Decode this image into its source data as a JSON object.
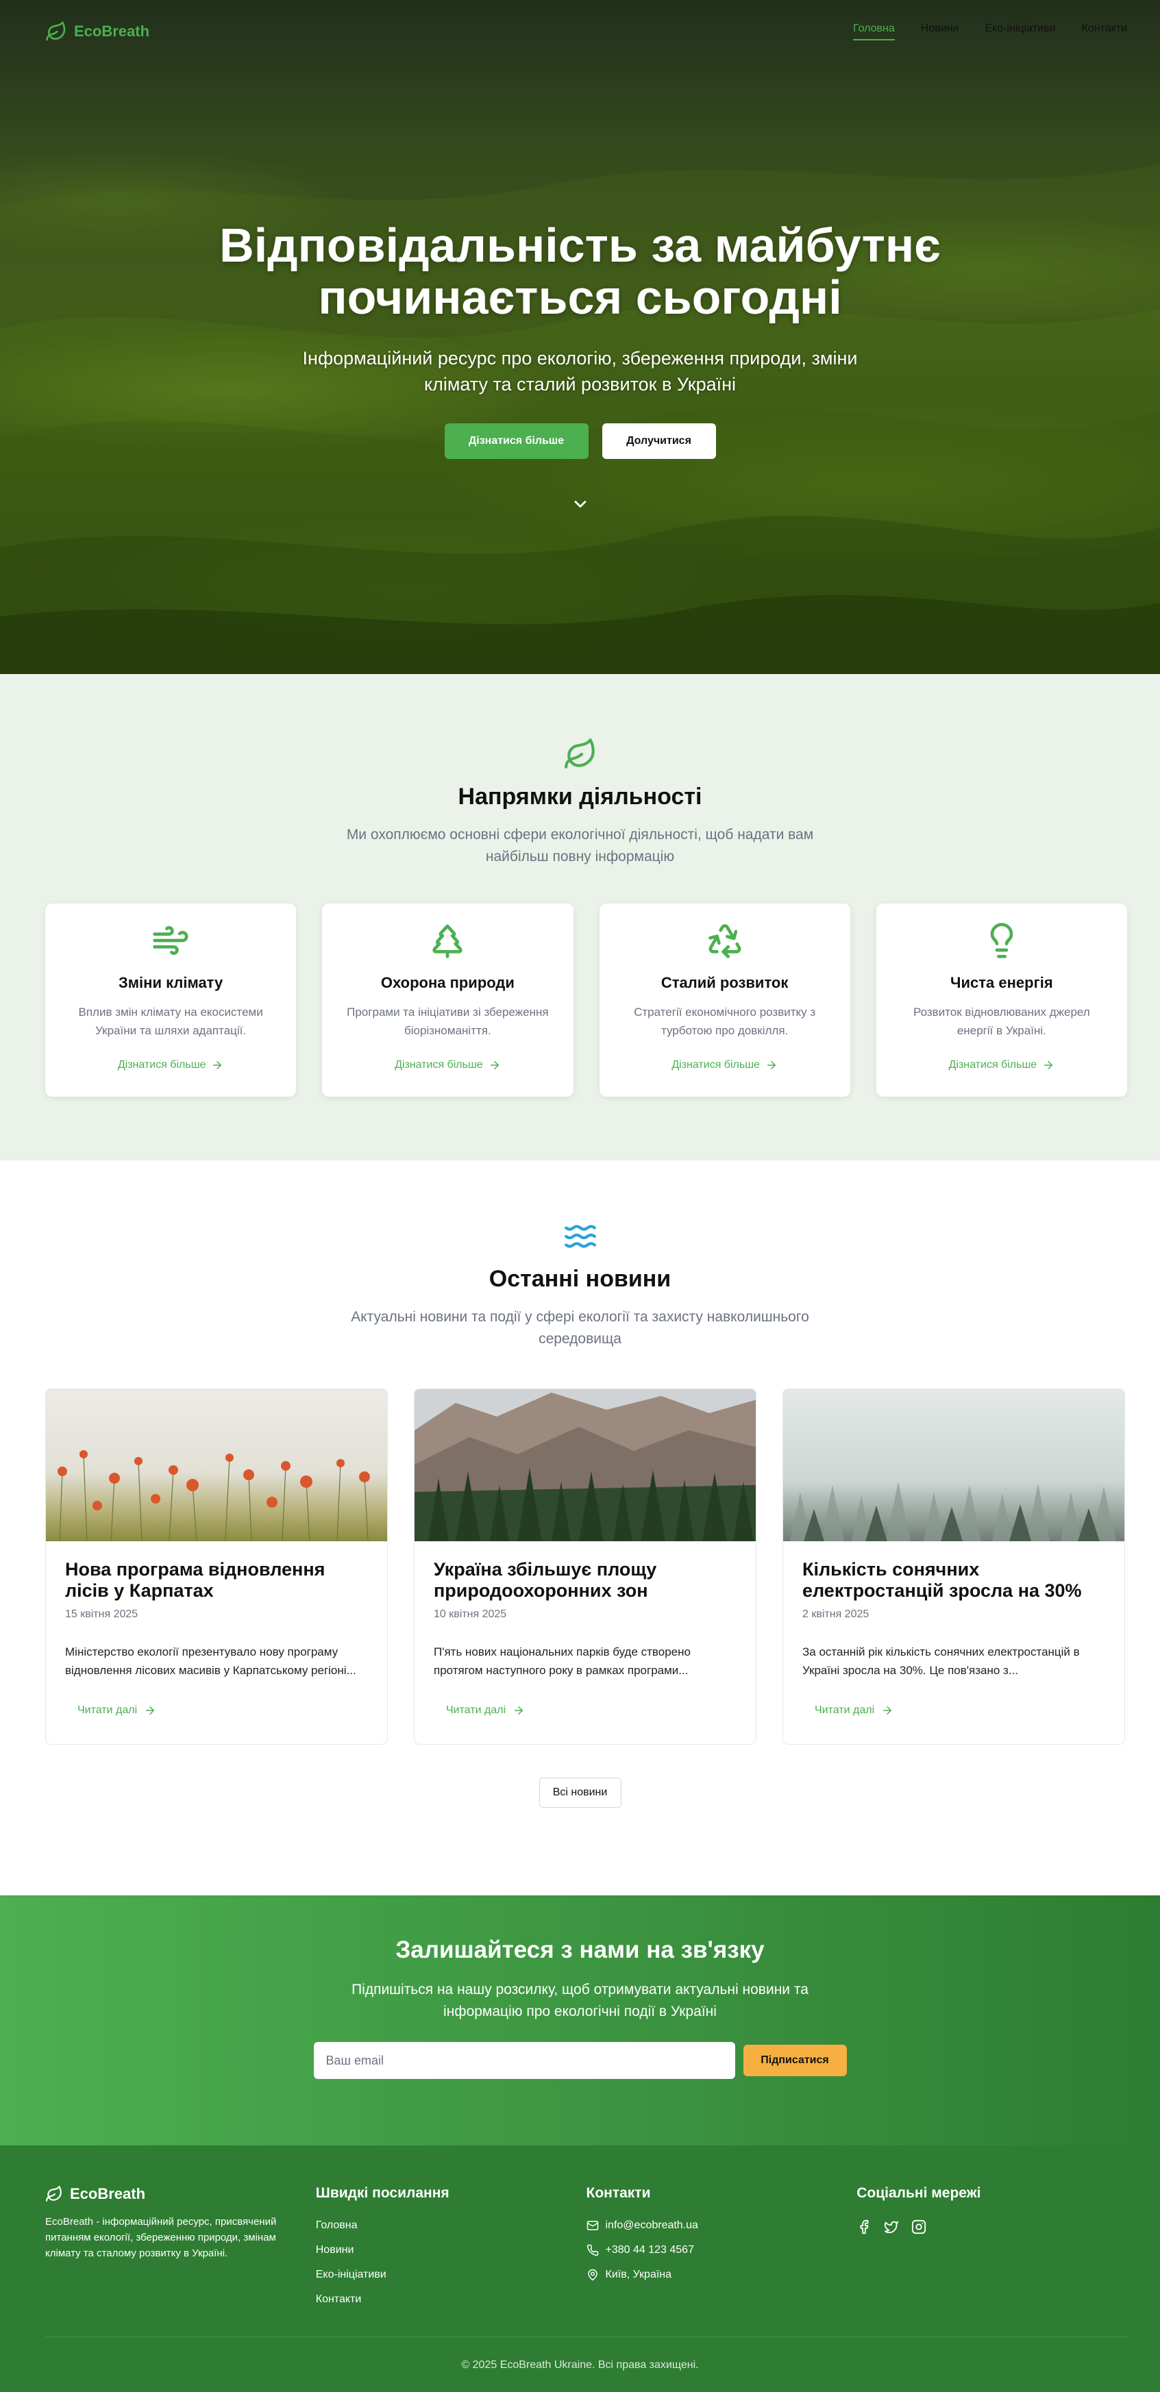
{
  "nav": {
    "brand": "EcoBreath",
    "links": [
      "Головна",
      "Новини",
      "Еко-ініціативи",
      "Контакти"
    ]
  },
  "hero": {
    "title": "Відповідальність за майбутнє починається сьогодні",
    "subtitle": "Інформаційний ресурс про екологію, збереження природи, зміни клімату та сталий розвиток в Україні",
    "primary_button": "Дізнатися більше",
    "secondary_button": "Долучитися"
  },
  "directions": {
    "title": "Напрямки діяльності",
    "subtitle": "Ми охоплюємо основні сфери екологічної діяльності, щоб надати вам найбільш повну інформацію",
    "cards": [
      {
        "icon": "wind-icon",
        "title": "Зміни клімату",
        "text": "Вплив змін клімату на екосистеми України та шляхи адаптації.",
        "link": "Дізнатися більше"
      },
      {
        "icon": "tree-icon",
        "title": "Охорона природи",
        "text": "Програми та ініціативи зі збереження біорізноманіття.",
        "link": "Дізнатися більше"
      },
      {
        "icon": "recycle-icon",
        "title": "Сталий розвиток",
        "text": "Стратегії економічного розвитку з турботою про довкілля.",
        "link": "Дізнатися більше"
      },
      {
        "icon": "lightbulb-icon",
        "title": "Чиста енергія",
        "text": "Розвиток відновлюваних джерел енергії в Україні.",
        "link": "Дізнатися більше"
      }
    ]
  },
  "news": {
    "title": "Останні новини",
    "subtitle": "Актуальні новини та події у сфері екології та захисту навколишнього середовища",
    "items": [
      {
        "title": "Нова програма відновлення лісів у Карпатах",
        "date": "15 квітня 2025",
        "excerpt": "Міністерство екології презентувало нову програму відновлення лісових масивів у Карпатському регіоні...",
        "link": "Читати далі"
      },
      {
        "title": "Україна збільшує площу природоохоронних зон",
        "date": "10 квітня 2025",
        "excerpt": "П'ять нових національних парків буде створено протягом наступного року в рамках програми...",
        "link": "Читати далі"
      },
      {
        "title": "Кількість сонячних електростанцій зросла на 30%",
        "date": "2 квітня 2025",
        "excerpt": "За останній рік кількість сонячних електростанцій в Україні зросла на 30%. Це пов'язано з...",
        "link": "Читати далі"
      }
    ],
    "all_button": "Всі новини"
  },
  "subscribe": {
    "title": "Залишайтеся з нами на зв'язку",
    "subtitle": "Підпишіться на нашу розсилку, щоб отримувати актуальні новини та інформацію про екологічні події в Україні",
    "placeholder": "Ваш email",
    "button": "Підписатися"
  },
  "footer": {
    "brand": "EcoBreath",
    "description": "EcoBreath - інформаційний ресурс, присвячений питанням екології, збереженню природи, змінам клімату та сталому розвитку в Україні.",
    "quick_title": "Швидкі посилання",
    "quick_links": [
      "Головна",
      "Новини",
      "Еко-ініціативи",
      "Контакти"
    ],
    "contacts_title": "Контакти",
    "email": "info@ecobreath.ua",
    "phone": "+380 44 123 4567",
    "address": "Київ, Україна",
    "social_title": "Соціальні мережі",
    "social": [
      "facebook-icon",
      "twitter-icon",
      "instagram-icon"
    ],
    "copyright": "© 2025 EcoBreath Ukraine. Всі права захищені."
  },
  "colors": {
    "accent": "#4caf50",
    "accent_dark": "#2e7d32",
    "subscribe_button": "#f5b041",
    "directions_bg": "#ebf2e9"
  }
}
